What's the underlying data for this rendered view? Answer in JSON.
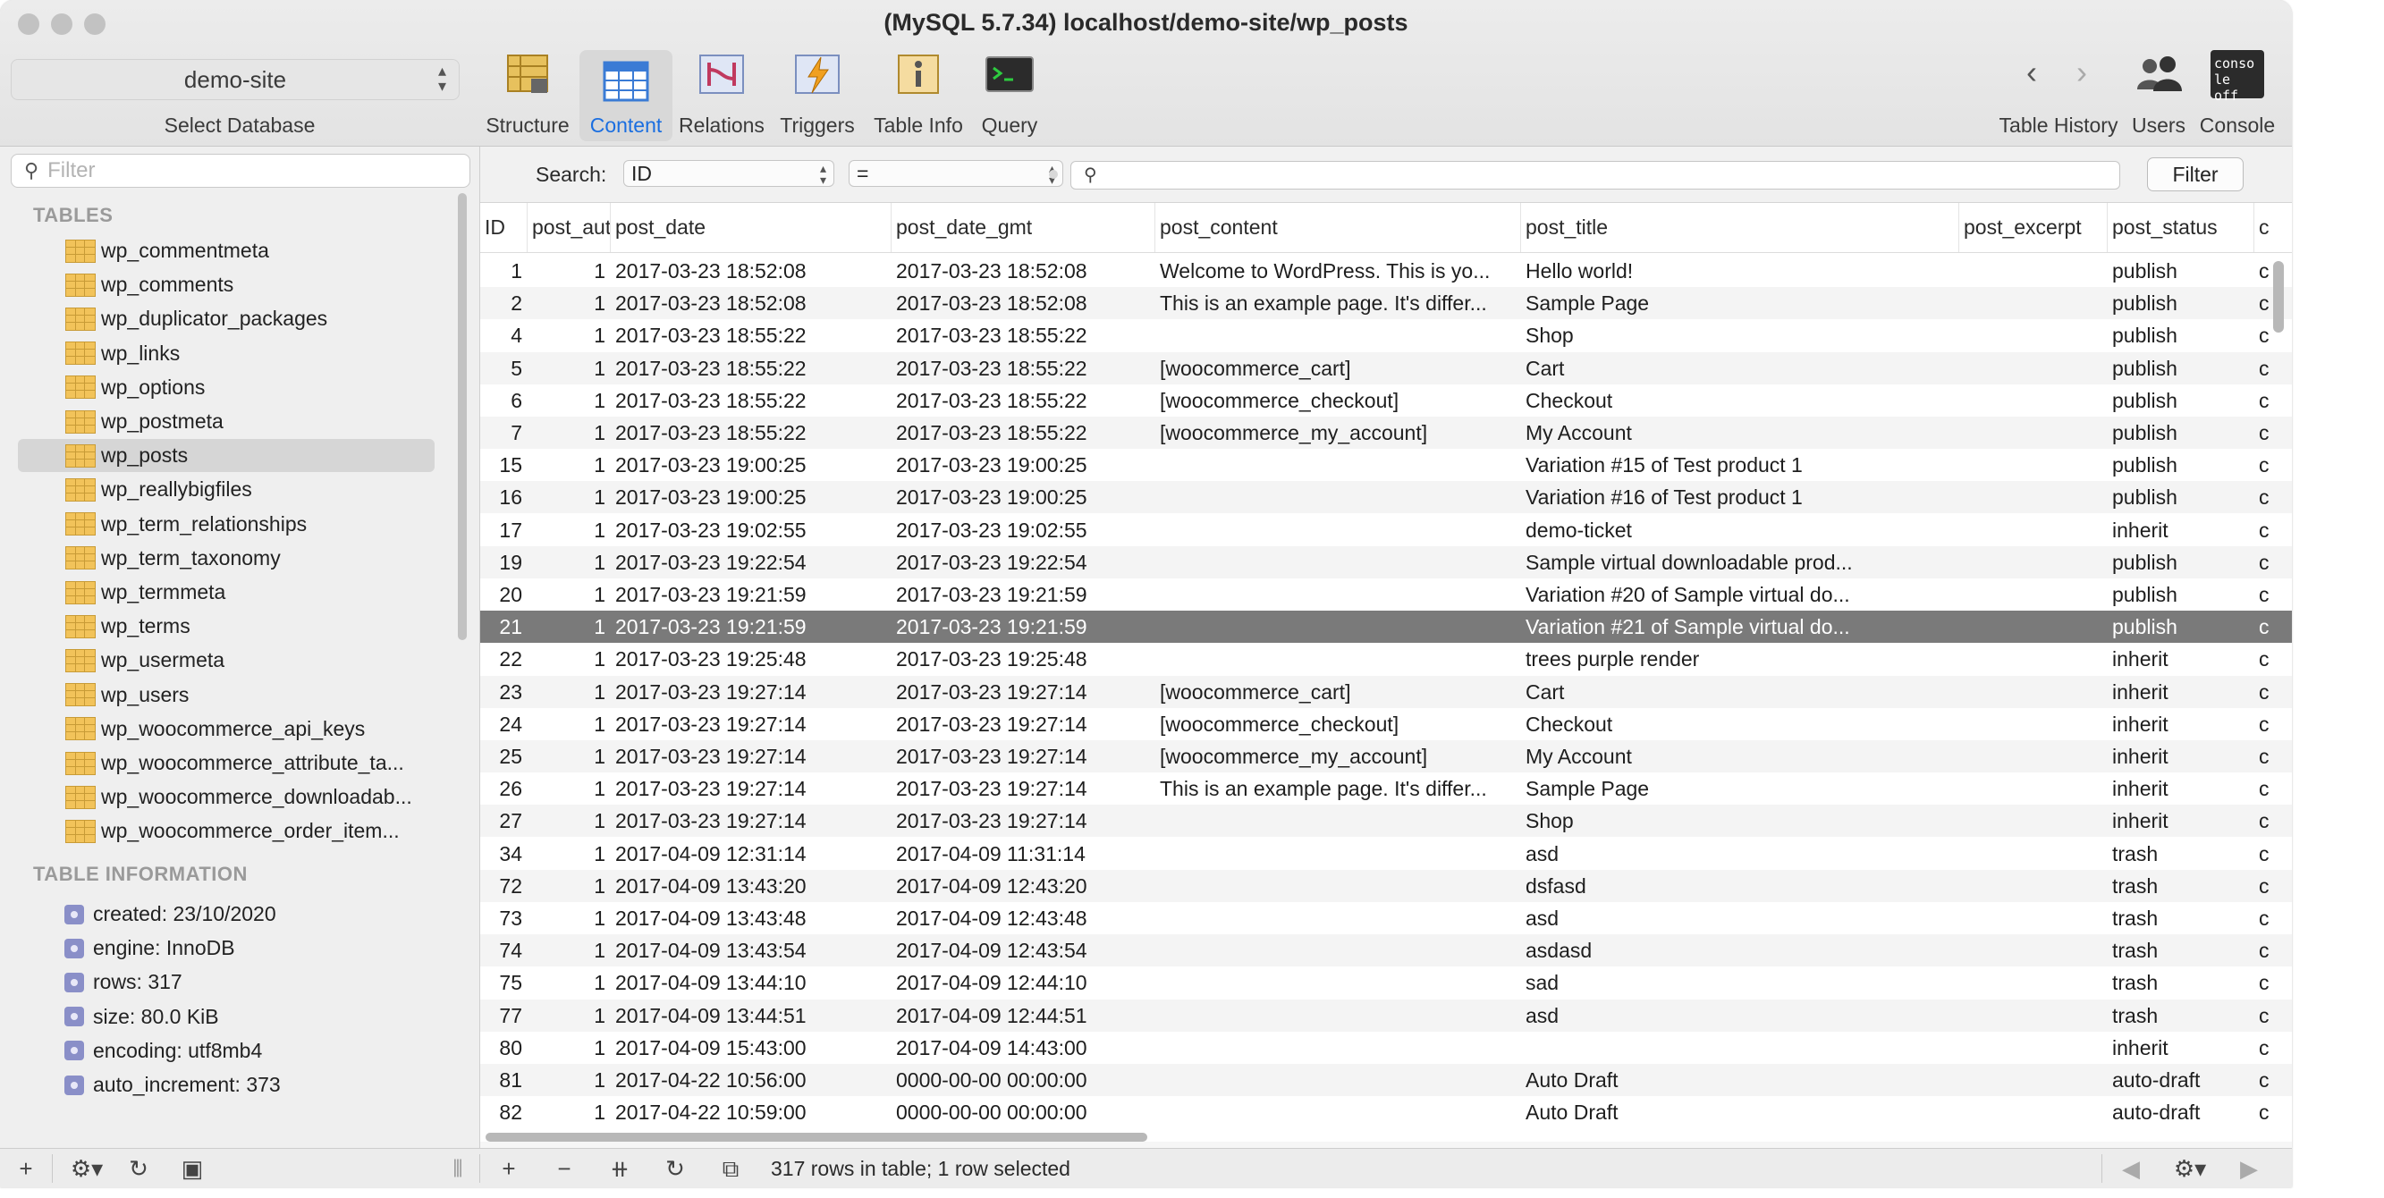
{
  "window": {
    "title": "(MySQL 5.7.34) localhost/demo-site/wp_posts"
  },
  "toolbar": {
    "database": "demo-site",
    "select_db_label": "Select Database",
    "buttons": [
      {
        "label": "Structure",
        "icon": "structure-icon"
      },
      {
        "label": "Content",
        "icon": "content-icon",
        "active": true
      },
      {
        "label": "Relations",
        "icon": "relations-icon"
      },
      {
        "label": "Triggers",
        "icon": "triggers-icon"
      },
      {
        "label": "Table Info",
        "icon": "table-info-icon"
      },
      {
        "label": "Query",
        "icon": "query-icon"
      }
    ],
    "right_buttons": [
      {
        "label": "Table History",
        "icon": "history-arrows-icon"
      },
      {
        "label": "Users",
        "icon": "users-icon"
      },
      {
        "label": "Console",
        "icon": "console-icon"
      }
    ],
    "console_icon_text": "conso le off"
  },
  "sidebar": {
    "filter_placeholder": "Filter",
    "tables_heading": "TABLES",
    "tables": [
      "wp_commentmeta",
      "wp_comments",
      "wp_duplicator_packages",
      "wp_links",
      "wp_options",
      "wp_postmeta",
      "wp_posts",
      "wp_reallybigfiles",
      "wp_term_relationships",
      "wp_term_taxonomy",
      "wp_termmeta",
      "wp_terms",
      "wp_usermeta",
      "wp_users",
      "wp_woocommerce_api_keys",
      "wp_woocommerce_attribute_ta...",
      "wp_woocommerce_downloadab...",
      "wp_woocommerce_order_item..."
    ],
    "selected_table": "wp_posts",
    "info_heading": "TABLE INFORMATION",
    "info": [
      "created: 23/10/2020",
      "engine: InnoDB",
      "rows: 317",
      "size: 80.0 KiB",
      "encoding: utf8mb4",
      "auto_increment: 373"
    ]
  },
  "search": {
    "label": "Search:",
    "field": "ID",
    "operator": "=",
    "filter_button": "Filter"
  },
  "table": {
    "columns": [
      "ID",
      "post_author",
      "post_date",
      "post_date_gmt",
      "post_content",
      "post_title",
      "post_excerpt",
      "post_status",
      "c"
    ],
    "selected_row_id": "21",
    "rows": [
      [
        "1",
        "1",
        "2017-03-23 18:52:08",
        "2017-03-23 18:52:08",
        "Welcome to WordPress. This is yo...",
        "Hello world!",
        "",
        "publish",
        "c"
      ],
      [
        "2",
        "1",
        "2017-03-23 18:52:08",
        "2017-03-23 18:52:08",
        "This is an example page. It's differ...",
        "Sample Page",
        "",
        "publish",
        "c"
      ],
      [
        "4",
        "1",
        "2017-03-23 18:55:22",
        "2017-03-23 18:55:22",
        "",
        "Shop",
        "",
        "publish",
        "c"
      ],
      [
        "5",
        "1",
        "2017-03-23 18:55:22",
        "2017-03-23 18:55:22",
        "[woocommerce_cart]",
        "Cart",
        "",
        "publish",
        "c"
      ],
      [
        "6",
        "1",
        "2017-03-23 18:55:22",
        "2017-03-23 18:55:22",
        "[woocommerce_checkout]",
        "Checkout",
        "",
        "publish",
        "c"
      ],
      [
        "7",
        "1",
        "2017-03-23 18:55:22",
        "2017-03-23 18:55:22",
        "[woocommerce_my_account]",
        "My Account",
        "",
        "publish",
        "c"
      ],
      [
        "15",
        "1",
        "2017-03-23 19:00:25",
        "2017-03-23 19:00:25",
        "",
        "Variation #15 of Test product 1",
        "",
        "publish",
        "c"
      ],
      [
        "16",
        "1",
        "2017-03-23 19:00:25",
        "2017-03-23 19:00:25",
        "",
        "Variation #16 of Test product 1",
        "",
        "publish",
        "c"
      ],
      [
        "17",
        "1",
        "2017-03-23 19:02:55",
        "2017-03-23 19:02:55",
        "",
        "demo-ticket",
        "",
        "inherit",
        "c"
      ],
      [
        "19",
        "1",
        "2017-03-23 19:22:54",
        "2017-03-23 19:22:54",
        "",
        "Sample virtual downloadable prod...",
        "",
        "publish",
        "c"
      ],
      [
        "20",
        "1",
        "2017-03-23 19:21:59",
        "2017-03-23 19:21:59",
        "",
        "Variation #20 of Sample virtual do...",
        "",
        "publish",
        "c"
      ],
      [
        "21",
        "1",
        "2017-03-23 19:21:59",
        "2017-03-23 19:21:59",
        "",
        "Variation #21 of Sample virtual do...",
        "",
        "publish",
        "c"
      ],
      [
        "22",
        "1",
        "2017-03-23 19:25:48",
        "2017-03-23 19:25:48",
        "",
        "trees purple render",
        "",
        "inherit",
        "c"
      ],
      [
        "23",
        "1",
        "2017-03-23 19:27:14",
        "2017-03-23 19:27:14",
        "[woocommerce_cart]",
        "Cart",
        "",
        "inherit",
        "c"
      ],
      [
        "24",
        "1",
        "2017-03-23 19:27:14",
        "2017-03-23 19:27:14",
        "[woocommerce_checkout]",
        "Checkout",
        "",
        "inherit",
        "c"
      ],
      [
        "25",
        "1",
        "2017-03-23 19:27:14",
        "2017-03-23 19:27:14",
        "[woocommerce_my_account]",
        "My Account",
        "",
        "inherit",
        "c"
      ],
      [
        "26",
        "1",
        "2017-03-23 19:27:14",
        "2017-03-23 19:27:14",
        "This is an example page. It's differ...",
        "Sample Page",
        "",
        "inherit",
        "c"
      ],
      [
        "27",
        "1",
        "2017-03-23 19:27:14",
        "2017-03-23 19:27:14",
        "",
        "Shop",
        "",
        "inherit",
        "c"
      ],
      [
        "34",
        "1",
        "2017-04-09 12:31:14",
        "2017-04-09 11:31:14",
        "",
        "asd",
        "",
        "trash",
        "c"
      ],
      [
        "72",
        "1",
        "2017-04-09 13:43:20",
        "2017-04-09 12:43:20",
        "",
        "dsfasd",
        "",
        "trash",
        "c"
      ],
      [
        "73",
        "1",
        "2017-04-09 13:43:48",
        "2017-04-09 12:43:48",
        "",
        "asd",
        "",
        "trash",
        "c"
      ],
      [
        "74",
        "1",
        "2017-04-09 13:43:54",
        "2017-04-09 12:43:54",
        "",
        "asdasd",
        "",
        "trash",
        "c"
      ],
      [
        "75",
        "1",
        "2017-04-09 13:44:10",
        "2017-04-09 12:44:10",
        "",
        "sad",
        "",
        "trash",
        "c"
      ],
      [
        "77",
        "1",
        "2017-04-09 13:44:51",
        "2017-04-09 12:44:51",
        "",
        "asd",
        "",
        "trash",
        "c"
      ],
      [
        "80",
        "1",
        "2017-04-09 15:43:00",
        "2017-04-09 14:43:00",
        "",
        "",
        "",
        "inherit",
        "c"
      ],
      [
        "81",
        "1",
        "2017-04-22 10:56:00",
        "0000-00-00 00:00:00",
        "",
        "Auto Draft",
        "",
        "auto-draft",
        "c"
      ],
      [
        "82",
        "1",
        "2017-04-22 10:59:00",
        "0000-00-00 00:00:00",
        "",
        "Auto Draft",
        "",
        "auto-draft",
        "c"
      ]
    ]
  },
  "status": {
    "text": "317 rows in table; 1 row selected"
  }
}
